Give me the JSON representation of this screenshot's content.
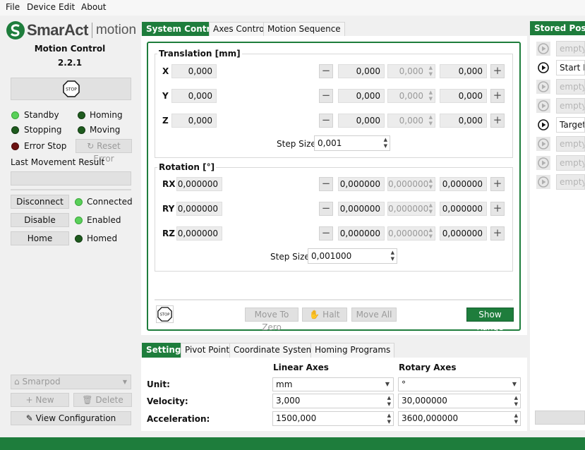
{
  "menu": {
    "file": "File",
    "device": "Device",
    "edit": "Edit",
    "about": "About"
  },
  "logo": {
    "brand": "SmarAct",
    "product": "motion"
  },
  "left": {
    "title": "Motion Control",
    "version": "2.2.1",
    "stop_label": "STOP",
    "status": {
      "standby": "Standby",
      "homing": "Homing",
      "stopping": "Stopping",
      "moving": "Moving",
      "error_stop": "Error Stop",
      "reset_error": "Reset Error"
    },
    "last_result_label": "Last Movement Result",
    "last_result_value": "",
    "disconnect": "Disconnect",
    "connected": "Connected",
    "disable": "Disable",
    "enabled": "Enabled",
    "home": "Home",
    "homed": "Homed",
    "device_select": "Smarpod",
    "new": "New",
    "delete": "Delete",
    "view_config": "View Configuration"
  },
  "top_tabs": [
    "System Control",
    "Axes Control",
    "Motion Sequence"
  ],
  "translation": {
    "title": "Translation [mm]",
    "axes": [
      {
        "label": "X",
        "value": "0,000",
        "target": "0,000",
        "delta": "0,000",
        "pos": "0,000"
      },
      {
        "label": "Y",
        "value": "0,000",
        "target": "0,000",
        "delta": "0,000",
        "pos": "0,000"
      },
      {
        "label": "Z",
        "value": "0,000",
        "target": "0,000",
        "delta": "0,000",
        "pos": "0,000"
      }
    ],
    "step_label": "Step Size:",
    "step_value": "0,001"
  },
  "rotation": {
    "title": "Rotation [°]",
    "axes": [
      {
        "label": "RX",
        "value": "0,000000",
        "target": "0,000000",
        "delta": "0,000000",
        "pos": "0,000000"
      },
      {
        "label": "RY",
        "value": "0,000000",
        "target": "0,000000",
        "delta": "0,000000",
        "pos": "0,000000"
      },
      {
        "label": "RZ",
        "value": "0,000000",
        "target": "0,000000",
        "delta": "0,000000",
        "pos": "0,000000"
      }
    ],
    "step_label": "Step Size:",
    "step_value": "0,001000"
  },
  "actions": {
    "stop_label": "STOP",
    "move_to_zero": "Move To Zero",
    "halt": "Halt",
    "move_all": "Move All",
    "show_range": "Show Range"
  },
  "bottom_tabs": [
    "Settings",
    "Pivot Point",
    "Coordinate Systems",
    "Homing Programs"
  ],
  "settings": {
    "linear_header": "Linear Axes",
    "rotary_header": "Rotary Axes",
    "unit_label": "Unit:",
    "unit_linear": "mm",
    "unit_rotary": "°",
    "velocity_label": "Velocity:",
    "velocity_linear": "3,000",
    "velocity_rotary": "30,000000",
    "acceleration_label": "Acceleration:",
    "acceleration_linear": "1500,000",
    "acceleration_rotary": "3600,000000"
  },
  "stored_poses": {
    "title": "Stored Poses",
    "items": [
      "empty",
      "Start Pose",
      "empty",
      "empty",
      "Target",
      "empty",
      "empty",
      "empty"
    ]
  },
  "colors": {
    "accent": "#1e7d3c",
    "led_on": "#5ad05a",
    "led_off": "#1e5b1e",
    "led_error": "#6b1111"
  }
}
